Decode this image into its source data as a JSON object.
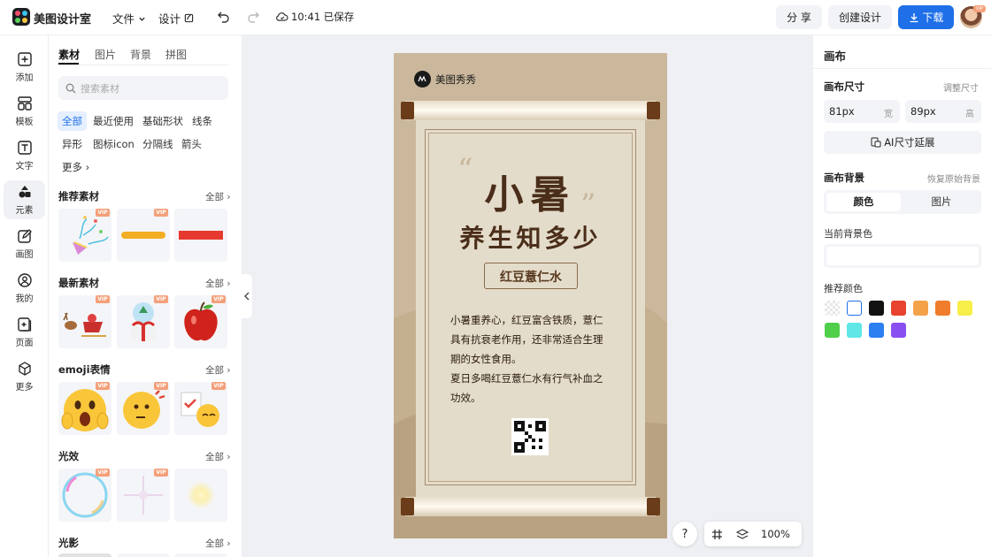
{
  "app": {
    "title": "美图设计室"
  },
  "topbar": {
    "file_menu": "文件",
    "design_menu": "设计",
    "save_status": "10:41 已保存",
    "share_label": "分 享",
    "create_label": "创建设计",
    "download_label": "下载",
    "avatar_vip": "VIP"
  },
  "leftnav": {
    "items": [
      {
        "label": "添加",
        "icon": "plus-square-icon"
      },
      {
        "label": "模板",
        "icon": "template-icon"
      },
      {
        "label": "文字",
        "icon": "text-icon"
      },
      {
        "label": "元素",
        "icon": "shapes-icon"
      },
      {
        "label": "画图",
        "icon": "draw-icon"
      },
      {
        "label": "我的",
        "icon": "user-icon"
      },
      {
        "label": "页面",
        "icon": "page-add-icon"
      },
      {
        "label": "更多",
        "icon": "cube-icon"
      }
    ],
    "active_index": 3
  },
  "assets": {
    "tabs": [
      "素材",
      "图片",
      "背景",
      "拼图"
    ],
    "search_placeholder": "搜索素材",
    "chips": [
      "全部",
      "最近使用",
      "基础形状",
      "线条",
      "异形",
      "图标icon",
      "分隔线",
      "箭头"
    ],
    "more_label": "更多",
    "sections": [
      {
        "title": "推荐素材",
        "all": "全部"
      },
      {
        "title": "最新素材",
        "all": "全部"
      },
      {
        "title": "emoji表情",
        "all": "全部"
      },
      {
        "title": "光效",
        "all": "全部"
      },
      {
        "title": "光影",
        "all": "全部"
      }
    ],
    "vip": "VIP"
  },
  "poster": {
    "brand": "美图秀秀",
    "title1": "小暑",
    "title2": "养生知多少",
    "badge": "红豆薏仁水",
    "paragraph1": "小暑重养心，红豆富含铁质，薏仁具有抗衰老作用，还非常适合生理期的女性食用。",
    "paragraph2": "夏日多喝红豆薏仁水有行气补血之功效。"
  },
  "bottombar": {
    "help": "?",
    "zoom": "100%"
  },
  "rightpanel": {
    "title": "画布",
    "size_label": "画布尺寸",
    "size_adjust": "调整尺寸",
    "width_value": "81px",
    "width_unit": "宽",
    "height_value": "89px",
    "height_unit": "高",
    "ai_extend": "AI尺寸延展",
    "bg_label": "画布背景",
    "bg_reset": "恢复原始背景",
    "bg_tab_color": "颜色",
    "bg_tab_image": "图片",
    "current_bg_label": "当前背景色",
    "recommend_label": "推荐颜色",
    "colors": [
      "transparent",
      "#ffffff",
      "#111111",
      "#e8432e",
      "#f4a24a",
      "#ef7d2b",
      "#f7ee4a",
      "#4fcf4a",
      "#5fe6e6",
      "#2d7ef0",
      "#8a4ff0"
    ]
  },
  "colors": {
    "accent": "#1e6fe8",
    "canvas_bg": "#eef0f4",
    "poster_brown": "#4a2e1a"
  }
}
